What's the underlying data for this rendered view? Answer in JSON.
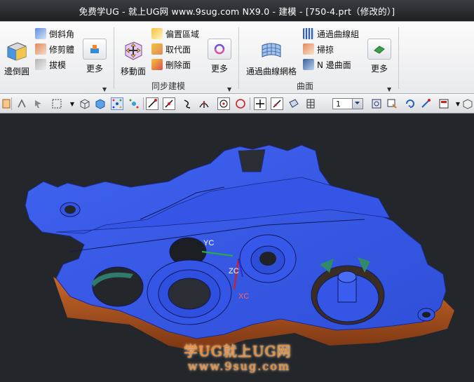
{
  "window": {
    "title": "免费学UG - 就上UG网 www.9sug.com NX9.0 - 建模 - [750-4.prt（修改的）]"
  },
  "ribbon": {
    "group1": {
      "big_button": "邊倒圓",
      "small_buttons": [
        "倒斜角",
        "修剪體",
        "拔模"
      ],
      "more_label": "更多"
    },
    "sync": {
      "big_button": "移動面",
      "small_buttons": [
        "偏置區域",
        "取代面",
        "刪除面"
      ],
      "more_label": "更多",
      "group_label": "同步建模"
    },
    "surface": {
      "big_button": "通過曲線網格",
      "small_buttons": [
        "通過曲線組",
        "掃掠",
        "N 邊曲面"
      ],
      "more_label": "更多",
      "group_label": "曲面"
    }
  },
  "toolbar": {
    "layer_value": "1"
  },
  "viewport": {
    "axis_labels": {
      "yc": "YC",
      "zc": "ZC",
      "xc": "XC"
    },
    "watermark_line1": "学UG就上UG网",
    "watermark_line2": "www.9sug.com"
  },
  "colors": {
    "part_face": "#3b5fe8",
    "part_side": "#b5541f",
    "background": "#23262b",
    "watermark": "#f08a2a"
  }
}
